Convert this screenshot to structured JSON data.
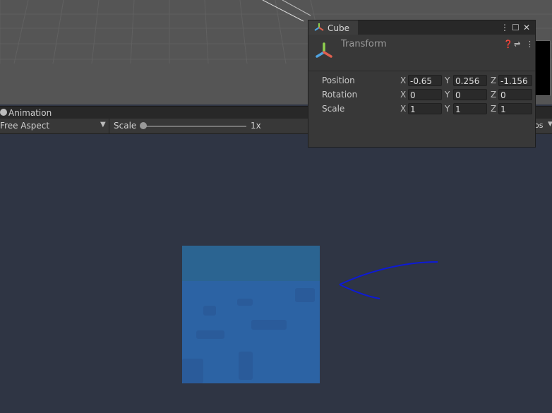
{
  "animation_window": {
    "tab_label": "Animation",
    "aspect_label": "Free Aspect",
    "scale_label": "Scale",
    "scale_value": "1x",
    "scale_level": 0,
    "right_partial": "os"
  },
  "inspector": {
    "tab_label": "Cube",
    "component_title": "Transform",
    "rows": [
      {
        "label": "Position",
        "x": "-0.65",
        "y": "0.256",
        "z": "-1.156"
      },
      {
        "label": "Rotation",
        "x": "0",
        "y": "0",
        "z": "0"
      },
      {
        "label": "Scale",
        "x": "1",
        "y": "1",
        "z": "1"
      }
    ],
    "axis_labels": {
      "x": "X",
      "y": "Y",
      "z": "Z"
    }
  },
  "colors": {
    "annotation": "#0d1ad6",
    "cube": "#2c63a4",
    "game_bg": "#2f3544"
  },
  "icons": [
    "animation-icon",
    "unity-axis-icon",
    "help-icon",
    "preset-icon",
    "kebab-menu-icon",
    "maximize-icon",
    "close-icon",
    "dropdown-arrow-icon"
  ]
}
